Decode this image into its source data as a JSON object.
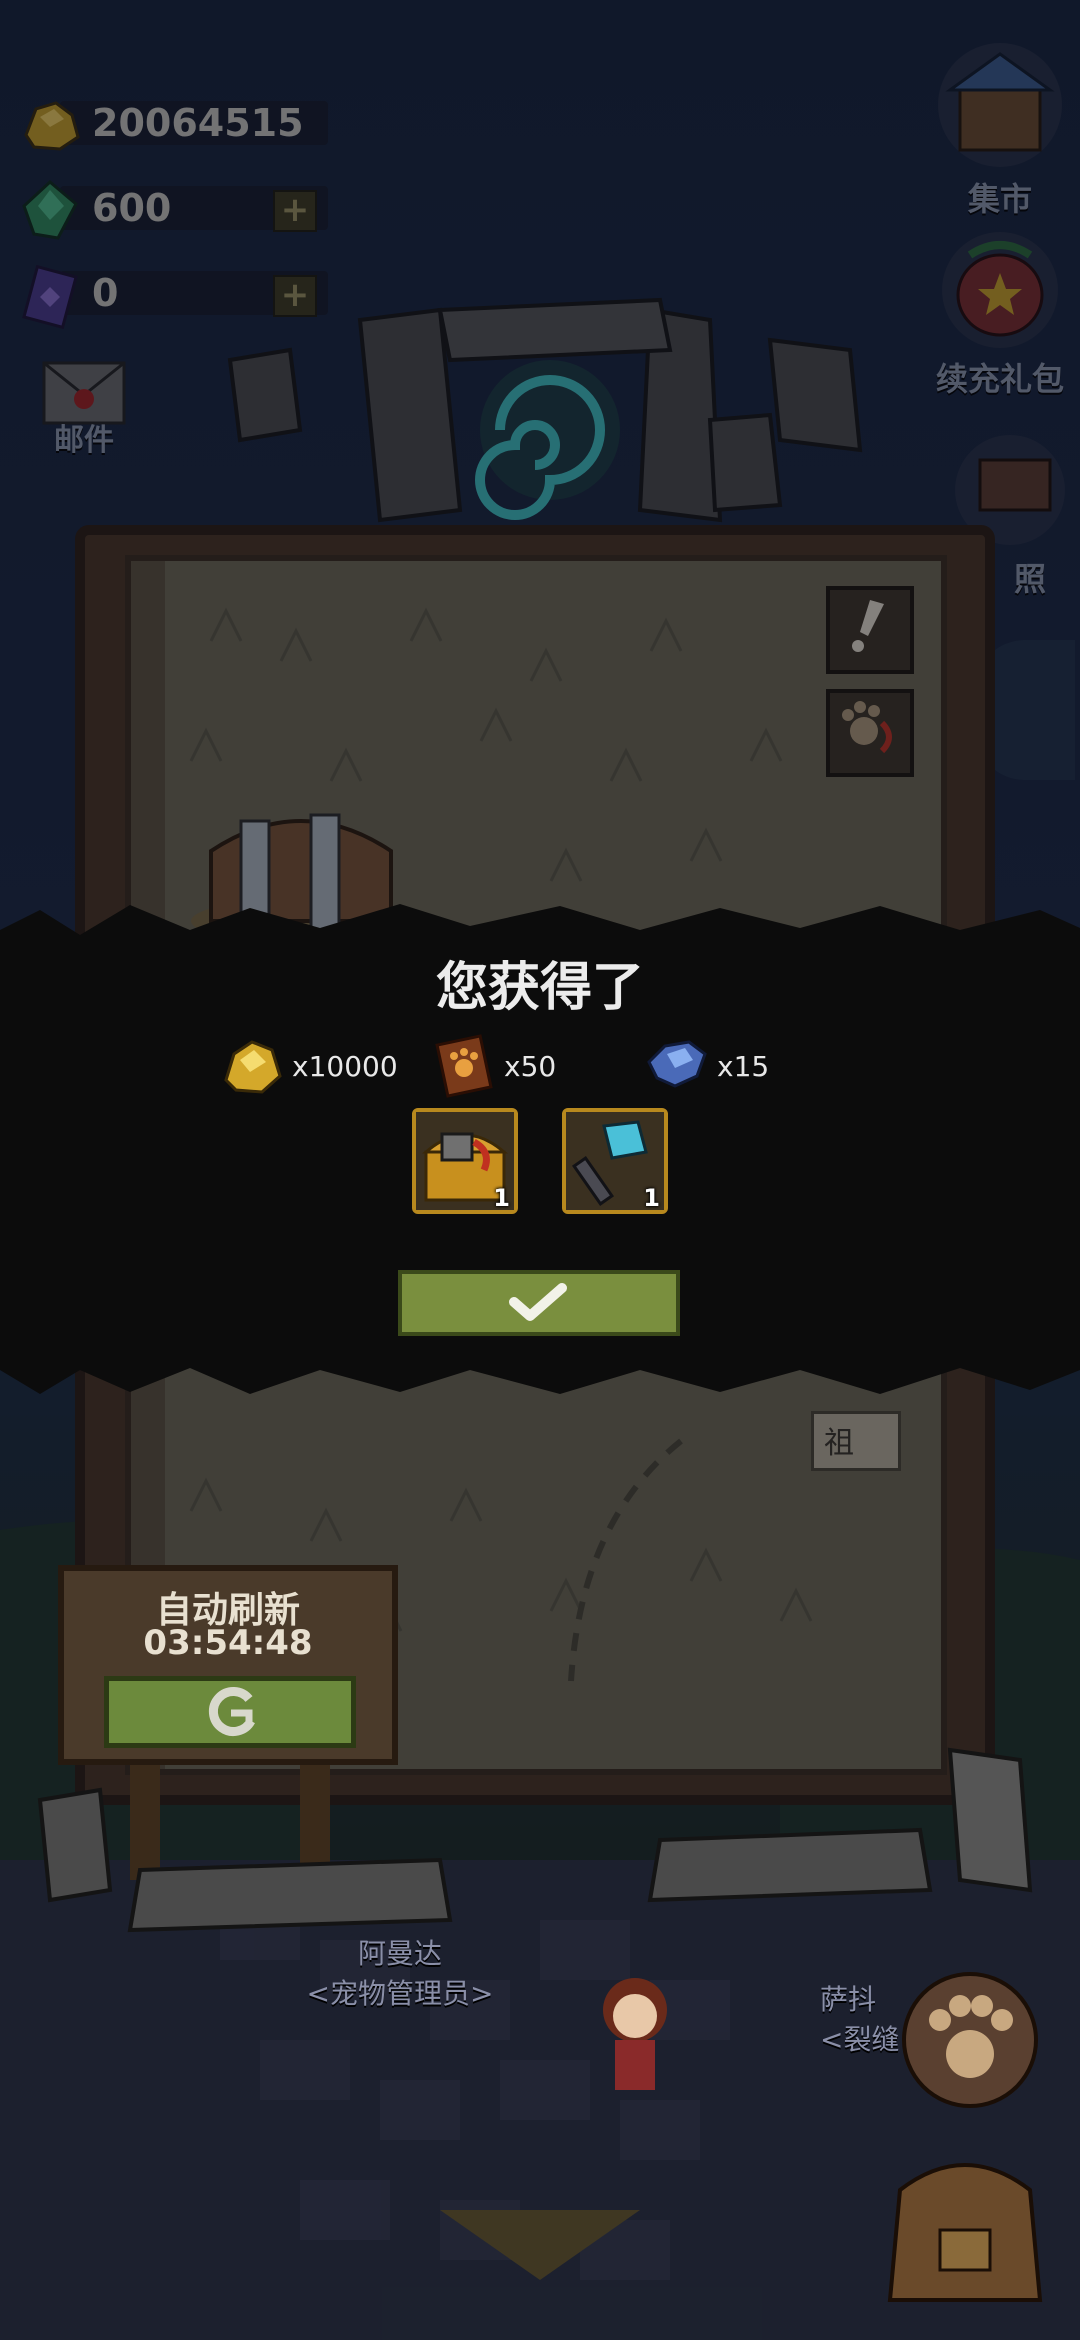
{
  "currencies": [
    {
      "name": "gold",
      "value": "20064515",
      "has_plus": false
    },
    {
      "name": "gem",
      "value": "600",
      "has_plus": true
    },
    {
      "name": "card",
      "value": "0",
      "has_plus": true
    }
  ],
  "plus_label": "+",
  "mail_label": "邮件",
  "right_menu": [
    {
      "label": "集市",
      "icon": "market-icon"
    },
    {
      "label": "续充礼包",
      "icon": "gift-pack-icon"
    },
    {
      "label": "照",
      "icon": "photo-icon"
    }
  ],
  "modal": {
    "title": "您获得了",
    "rewards": [
      {
        "icon": "gold-ore-icon",
        "count": "x10000"
      },
      {
        "icon": "paw-book-icon",
        "count": "x50"
      },
      {
        "icon": "blue-ore-icon",
        "count": "x15"
      }
    ],
    "items": [
      {
        "icon": "treasure-chest-item-icon",
        "count": "1"
      },
      {
        "icon": "hammer-item-icon",
        "count": "1"
      }
    ],
    "confirm_icon": "checkmark-icon"
  },
  "map": {
    "side_label": "祖"
  },
  "auto_refresh": {
    "title": "自动刷新",
    "timer": "03:54:48"
  },
  "npcs": [
    {
      "name": "阿曼达",
      "role": "<宠物管理员>"
    },
    {
      "name": "萨抖",
      "role": "<裂缝"
    }
  ],
  "colors": {
    "confirm_green": "#7a8f3e",
    "tile_gold": "#b8891e",
    "frame_brown": "#4a3422"
  }
}
